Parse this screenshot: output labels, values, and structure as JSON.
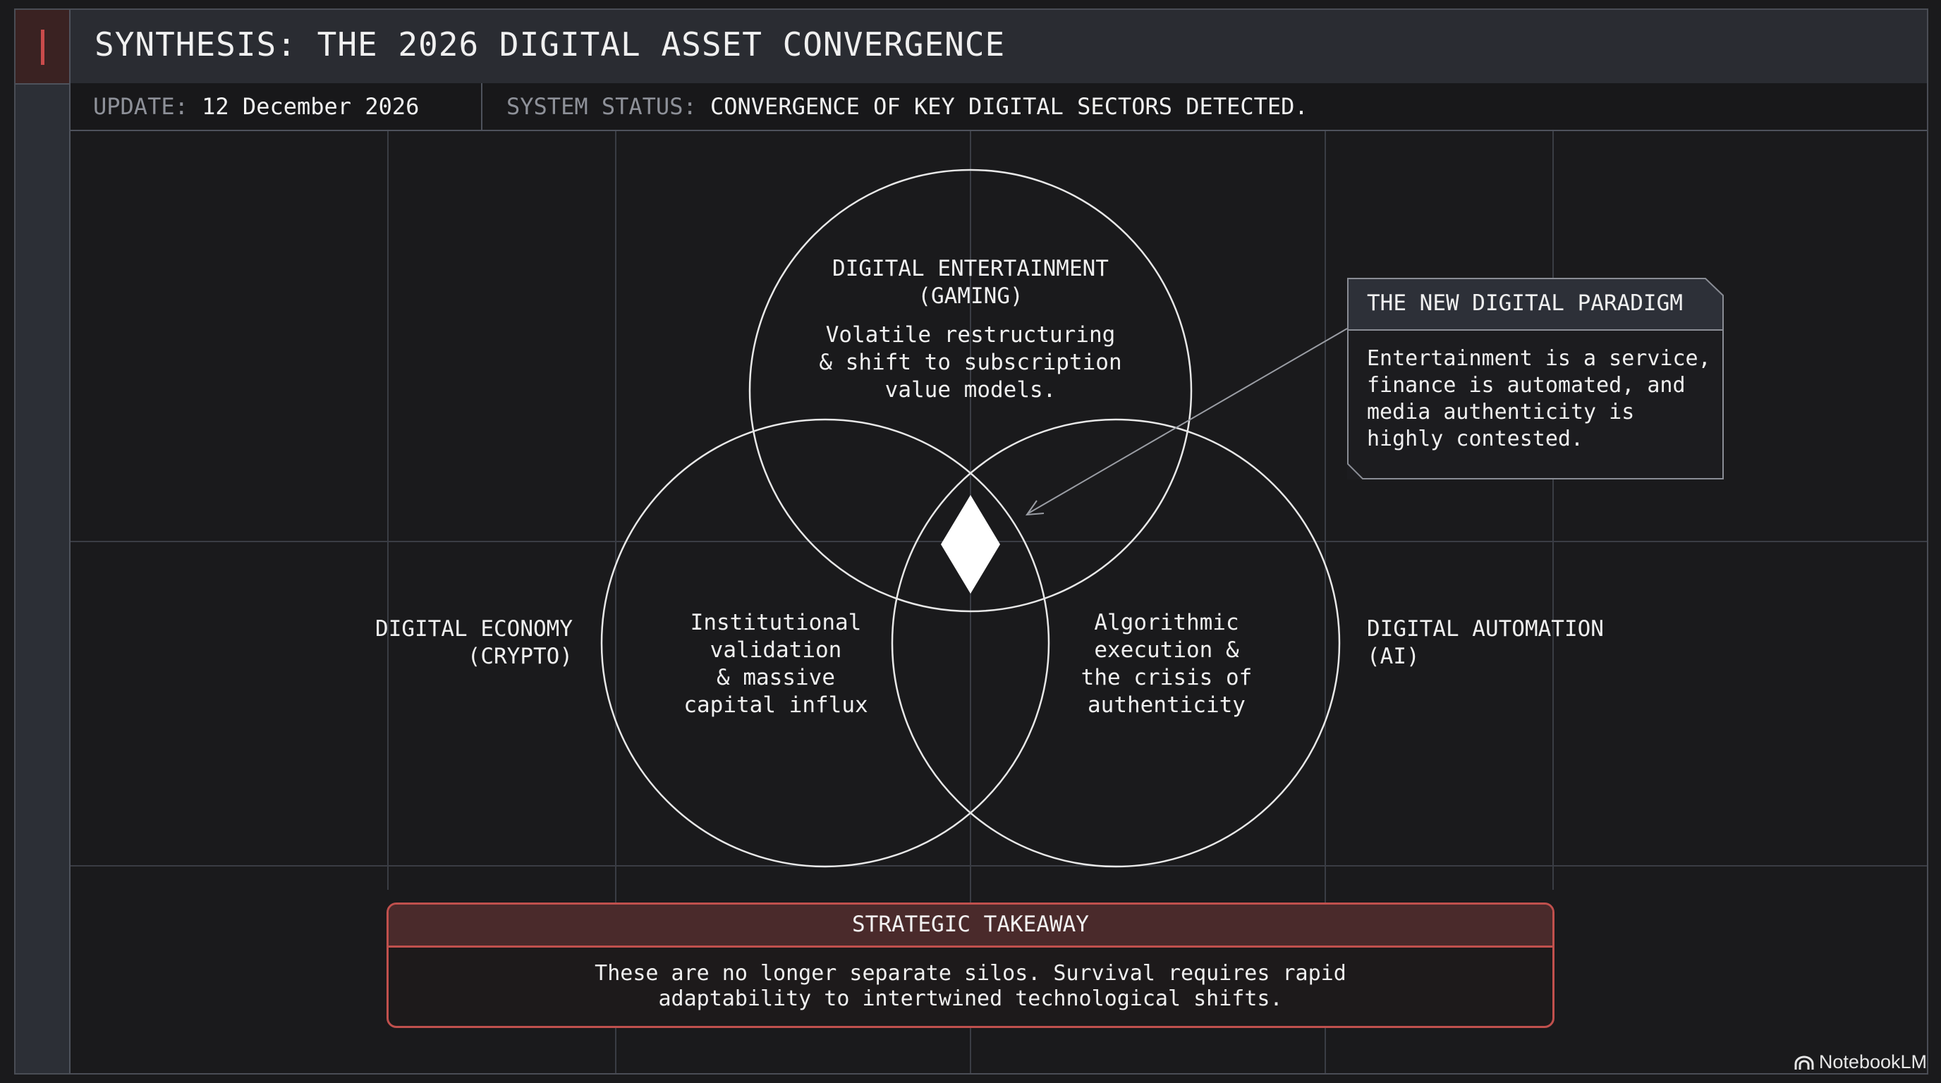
{
  "header": {
    "title": "SYNTHESIS: THE 2026 DIGITAL ASSET CONVERGENCE"
  },
  "status": {
    "update_key": "UPDATE:",
    "update_value": "12 December 2026",
    "system_key": "SYSTEM STATUS:",
    "system_value": "CONVERGENCE OF KEY DIGITAL SECTORS DETECTED."
  },
  "venn": {
    "top": {
      "title_lines": [
        "DIGITAL ENTERTAINMENT",
        "(GAMING)"
      ],
      "desc_lines": [
        "Volatile restructuring",
        "& shift to subscription",
        "value models."
      ]
    },
    "left": {
      "label_lines": [
        "DIGITAL ECONOMY",
        "(CRYPTO)"
      ],
      "desc_lines": [
        "Institutional",
        "validation",
        "& massive",
        "capital influx"
      ]
    },
    "right": {
      "label_lines": [
        "DIGITAL AUTOMATION",
        "(AI)"
      ],
      "desc_lines": [
        "Algorithmic",
        "execution &",
        "the crisis of",
        "authenticity"
      ]
    },
    "center_icon": "diamond-icon"
  },
  "callout": {
    "title": "THE NEW DIGITAL PARADIGM",
    "body_lines": [
      "Entertainment is a service,",
      "finance is automated, and",
      "media authenticity is",
      "highly contested."
    ]
  },
  "takeaway": {
    "title": "STRATEGIC TAKEAWAY",
    "body_lines": [
      "These are no longer separate silos. Survival requires rapid",
      "adaptability to intertwined technological shifts."
    ]
  },
  "brand": {
    "name": "NotebookLM",
    "icon": "notebooklm-logo-icon"
  },
  "colors": {
    "background": "#1a1a1c",
    "accent_red": "#c0504d",
    "grid_line": "#3a3d44",
    "circle_stroke": "#e8e8e8"
  }
}
